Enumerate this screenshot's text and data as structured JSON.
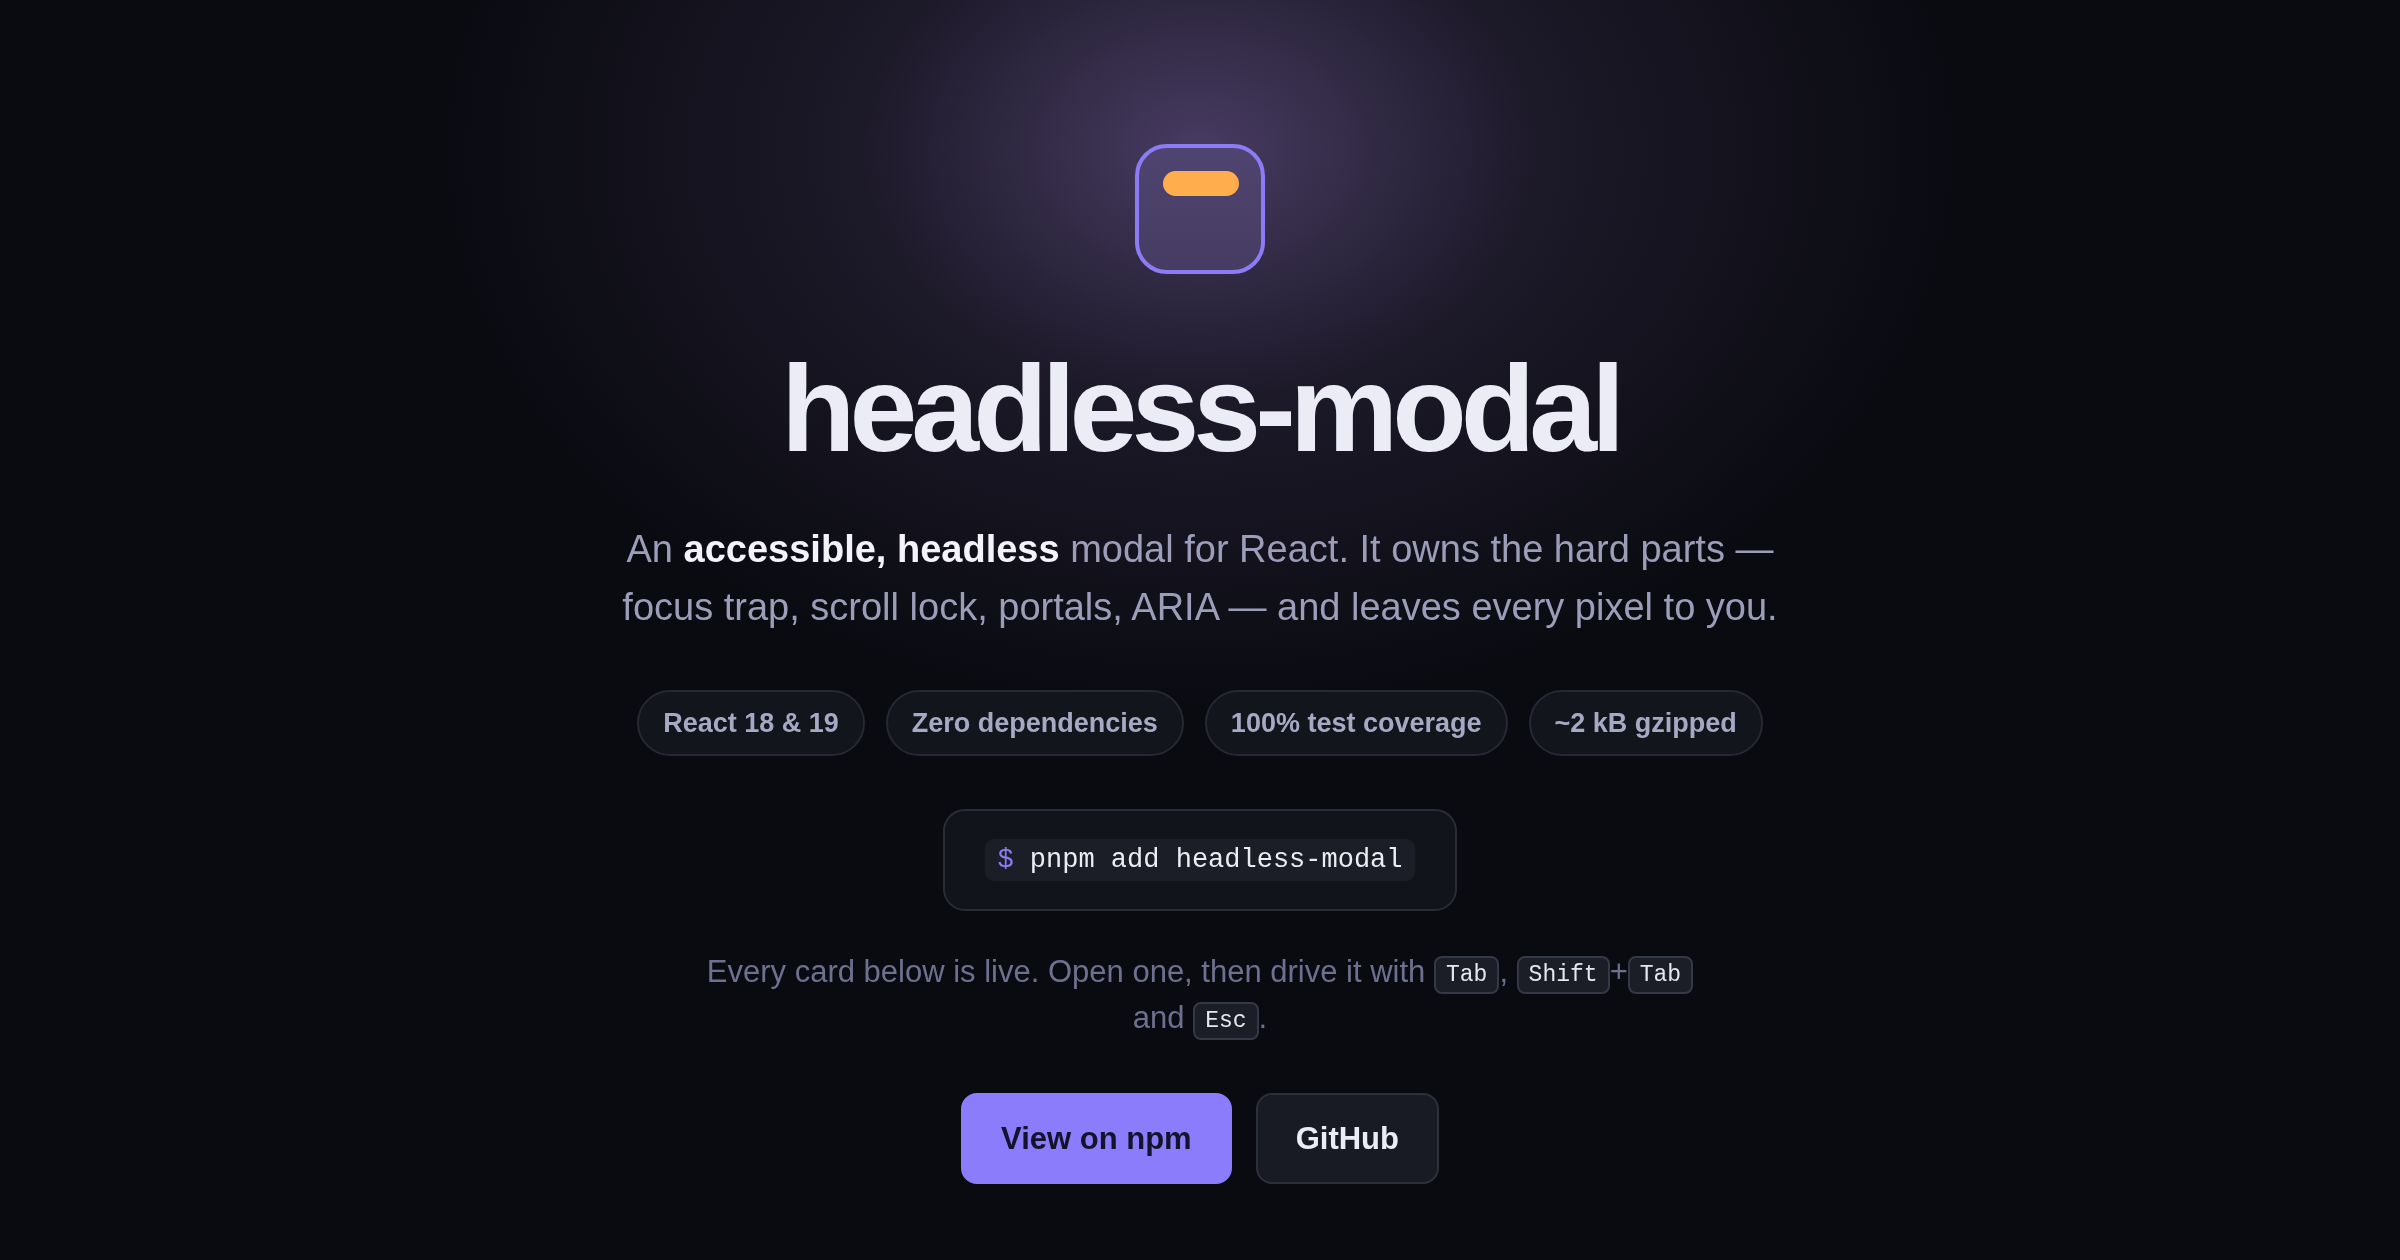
{
  "title": "headless-modal",
  "tagline": "An **accessible, headless** modal for React. It owns the hard parts — focus trap, scroll lock, portals, ARIA — and leaves every pixel to you.",
  "badges": [
    "React 18 & 19",
    "Zero dependencies",
    "100% test coverage",
    "~2 kB gzipped"
  ],
  "install": {
    "prompt": "$",
    "command": "pnpm add headless-modal"
  },
  "hint": [
    {
      "kind": "text",
      "text": "Every card below is live. Open one, then drive it with "
    },
    {
      "kind": "key",
      "text": "Tab"
    },
    {
      "kind": "text",
      "text": ", "
    },
    {
      "kind": "key",
      "text": "Shift"
    },
    {
      "kind": "text",
      "text": "+"
    },
    {
      "kind": "key",
      "text": "Tab"
    },
    {
      "kind": "text",
      "text": " and "
    },
    {
      "kind": "key",
      "text": "Esc"
    },
    {
      "kind": "text",
      "text": "."
    }
  ],
  "buttons": [
    {
      "label": "View on npm",
      "kind": "primary"
    },
    {
      "label": "GitHub",
      "kind": "secondary"
    }
  ]
}
